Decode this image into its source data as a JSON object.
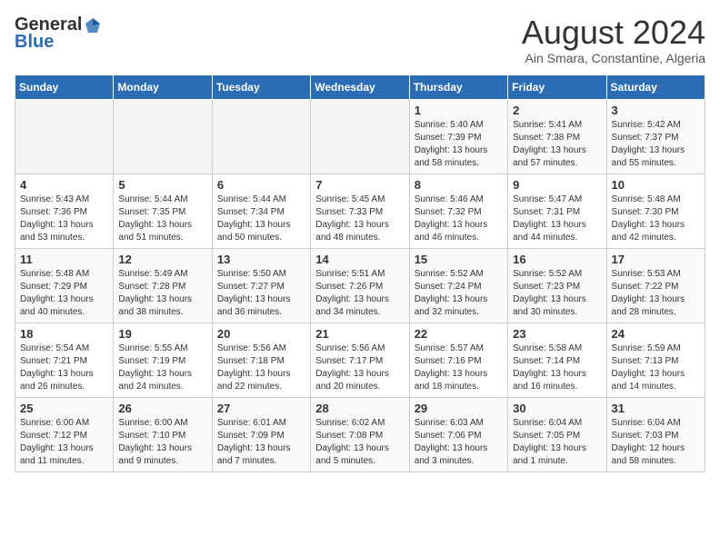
{
  "logo": {
    "general": "General",
    "blue": "Blue"
  },
  "title": "August 2024",
  "location": "Ain Smara, Constantine, Algeria",
  "weekdays": [
    "Sunday",
    "Monday",
    "Tuesday",
    "Wednesday",
    "Thursday",
    "Friday",
    "Saturday"
  ],
  "weeks": [
    [
      {
        "day": "",
        "info": ""
      },
      {
        "day": "",
        "info": ""
      },
      {
        "day": "",
        "info": ""
      },
      {
        "day": "",
        "info": ""
      },
      {
        "day": "1",
        "info": "Sunrise: 5:40 AM\nSunset: 7:39 PM\nDaylight: 13 hours\nand 58 minutes."
      },
      {
        "day": "2",
        "info": "Sunrise: 5:41 AM\nSunset: 7:38 PM\nDaylight: 13 hours\nand 57 minutes."
      },
      {
        "day": "3",
        "info": "Sunrise: 5:42 AM\nSunset: 7:37 PM\nDaylight: 13 hours\nand 55 minutes."
      }
    ],
    [
      {
        "day": "4",
        "info": "Sunrise: 5:43 AM\nSunset: 7:36 PM\nDaylight: 13 hours\nand 53 minutes."
      },
      {
        "day": "5",
        "info": "Sunrise: 5:44 AM\nSunset: 7:35 PM\nDaylight: 13 hours\nand 51 minutes."
      },
      {
        "day": "6",
        "info": "Sunrise: 5:44 AM\nSunset: 7:34 PM\nDaylight: 13 hours\nand 50 minutes."
      },
      {
        "day": "7",
        "info": "Sunrise: 5:45 AM\nSunset: 7:33 PM\nDaylight: 13 hours\nand 48 minutes."
      },
      {
        "day": "8",
        "info": "Sunrise: 5:46 AM\nSunset: 7:32 PM\nDaylight: 13 hours\nand 46 minutes."
      },
      {
        "day": "9",
        "info": "Sunrise: 5:47 AM\nSunset: 7:31 PM\nDaylight: 13 hours\nand 44 minutes."
      },
      {
        "day": "10",
        "info": "Sunrise: 5:48 AM\nSunset: 7:30 PM\nDaylight: 13 hours\nand 42 minutes."
      }
    ],
    [
      {
        "day": "11",
        "info": "Sunrise: 5:48 AM\nSunset: 7:29 PM\nDaylight: 13 hours\nand 40 minutes."
      },
      {
        "day": "12",
        "info": "Sunrise: 5:49 AM\nSunset: 7:28 PM\nDaylight: 13 hours\nand 38 minutes."
      },
      {
        "day": "13",
        "info": "Sunrise: 5:50 AM\nSunset: 7:27 PM\nDaylight: 13 hours\nand 36 minutes."
      },
      {
        "day": "14",
        "info": "Sunrise: 5:51 AM\nSunset: 7:26 PM\nDaylight: 13 hours\nand 34 minutes."
      },
      {
        "day": "15",
        "info": "Sunrise: 5:52 AM\nSunset: 7:24 PM\nDaylight: 13 hours\nand 32 minutes."
      },
      {
        "day": "16",
        "info": "Sunrise: 5:52 AM\nSunset: 7:23 PM\nDaylight: 13 hours\nand 30 minutes."
      },
      {
        "day": "17",
        "info": "Sunrise: 5:53 AM\nSunset: 7:22 PM\nDaylight: 13 hours\nand 28 minutes."
      }
    ],
    [
      {
        "day": "18",
        "info": "Sunrise: 5:54 AM\nSunset: 7:21 PM\nDaylight: 13 hours\nand 26 minutes."
      },
      {
        "day": "19",
        "info": "Sunrise: 5:55 AM\nSunset: 7:19 PM\nDaylight: 13 hours\nand 24 minutes."
      },
      {
        "day": "20",
        "info": "Sunrise: 5:56 AM\nSunset: 7:18 PM\nDaylight: 13 hours\nand 22 minutes."
      },
      {
        "day": "21",
        "info": "Sunrise: 5:56 AM\nSunset: 7:17 PM\nDaylight: 13 hours\nand 20 minutes."
      },
      {
        "day": "22",
        "info": "Sunrise: 5:57 AM\nSunset: 7:16 PM\nDaylight: 13 hours\nand 18 minutes."
      },
      {
        "day": "23",
        "info": "Sunrise: 5:58 AM\nSunset: 7:14 PM\nDaylight: 13 hours\nand 16 minutes."
      },
      {
        "day": "24",
        "info": "Sunrise: 5:59 AM\nSunset: 7:13 PM\nDaylight: 13 hours\nand 14 minutes."
      }
    ],
    [
      {
        "day": "25",
        "info": "Sunrise: 6:00 AM\nSunset: 7:12 PM\nDaylight: 13 hours\nand 11 minutes."
      },
      {
        "day": "26",
        "info": "Sunrise: 6:00 AM\nSunset: 7:10 PM\nDaylight: 13 hours\nand 9 minutes."
      },
      {
        "day": "27",
        "info": "Sunrise: 6:01 AM\nSunset: 7:09 PM\nDaylight: 13 hours\nand 7 minutes."
      },
      {
        "day": "28",
        "info": "Sunrise: 6:02 AM\nSunset: 7:08 PM\nDaylight: 13 hours\nand 5 minutes."
      },
      {
        "day": "29",
        "info": "Sunrise: 6:03 AM\nSunset: 7:06 PM\nDaylight: 13 hours\nand 3 minutes."
      },
      {
        "day": "30",
        "info": "Sunrise: 6:04 AM\nSunset: 7:05 PM\nDaylight: 13 hours\nand 1 minute."
      },
      {
        "day": "31",
        "info": "Sunrise: 6:04 AM\nSunset: 7:03 PM\nDaylight: 12 hours\nand 58 minutes."
      }
    ]
  ]
}
